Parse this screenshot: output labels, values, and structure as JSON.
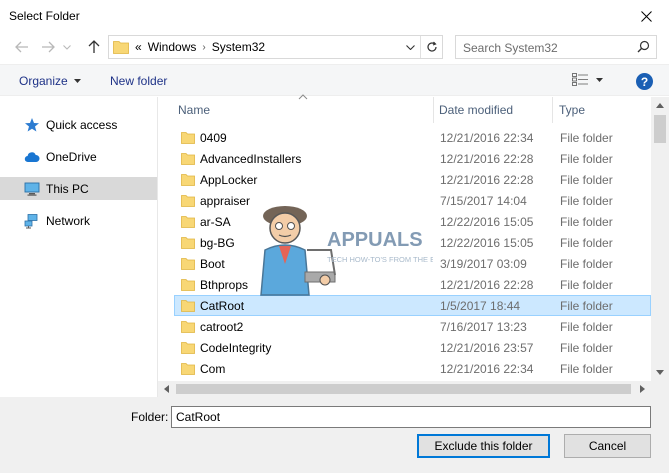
{
  "window": {
    "title": "Select Folder"
  },
  "address": {
    "crumbs": [
      "«",
      "Windows",
      "System32"
    ]
  },
  "search": {
    "placeholder": "Search System32"
  },
  "toolbar": {
    "organize": "Organize",
    "new_folder": "New folder"
  },
  "nav": {
    "items": [
      {
        "label": "Quick access",
        "icon": "star-icon"
      },
      {
        "label": "OneDrive",
        "icon": "cloud-icon"
      },
      {
        "label": "This PC",
        "icon": "monitor-icon",
        "selected": true
      },
      {
        "label": "Network",
        "icon": "network-icon"
      }
    ]
  },
  "columns": {
    "name": "Name",
    "date": "Date modified",
    "type": "Type"
  },
  "files": [
    {
      "name": "0409",
      "date": "12/21/2016 22:34",
      "type": "File folder"
    },
    {
      "name": "AdvancedInstallers",
      "date": "12/21/2016 22:28",
      "type": "File folder"
    },
    {
      "name": "AppLocker",
      "date": "12/21/2016 22:28",
      "type": "File folder"
    },
    {
      "name": "appraiser",
      "date": "7/15/2017 14:04",
      "type": "File folder"
    },
    {
      "name": "ar-SA",
      "date": "12/22/2016 15:05",
      "type": "File folder"
    },
    {
      "name": "bg-BG",
      "date": "12/22/2016 15:05",
      "type": "File folder"
    },
    {
      "name": "Boot",
      "date": "3/19/2017 03:09",
      "type": "File folder"
    },
    {
      "name": "Bthprops",
      "date": "12/21/2016 22:28",
      "type": "File folder"
    },
    {
      "name": "CatRoot",
      "date": "1/5/2017 18:44",
      "type": "File folder",
      "selected": true
    },
    {
      "name": "catroot2",
      "date": "7/16/2017 13:23",
      "type": "File folder"
    },
    {
      "name": "CodeIntegrity",
      "date": "12/21/2016 23:57",
      "type": "File folder"
    },
    {
      "name": "Com",
      "date": "12/21/2016 22:34",
      "type": "File folder"
    }
  ],
  "footer": {
    "folder_label": "Folder:",
    "folder_value": "CatRoot",
    "exclude_button": "Exclude this folder",
    "cancel_button": "Cancel"
  },
  "watermark": {
    "brand": "APPUALS",
    "tagline": "TECH HOW-TO'S FROM THE EXPERTS!"
  },
  "colors": {
    "accent": "#0078d7",
    "selection": "#cce8ff",
    "folder": "#f8d775",
    "link": "#1e3287"
  }
}
